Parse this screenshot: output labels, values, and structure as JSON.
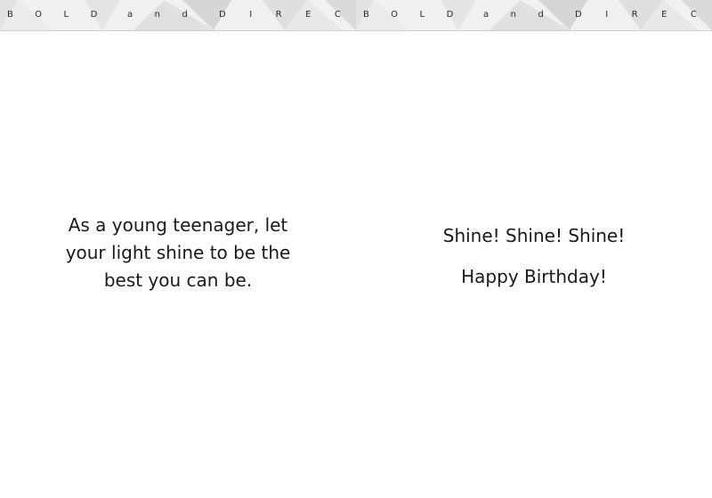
{
  "banner": {
    "word1": "BOLD",
    "word2": "and",
    "word3": "DIRECT"
  },
  "left_panel": {
    "lines": [
      "As a young teenager, let",
      "your light shine to be the",
      "best you can be."
    ]
  },
  "right_panel": {
    "line1": "Shine! Shine! Shine!",
    "line2": "Happy Birthday!"
  },
  "colors": {
    "banner_light": "#f1f1f1",
    "banner_mid": "#e2e2e2",
    "banner_dark": "#d2d2d2",
    "text": "#1a1a1a"
  }
}
